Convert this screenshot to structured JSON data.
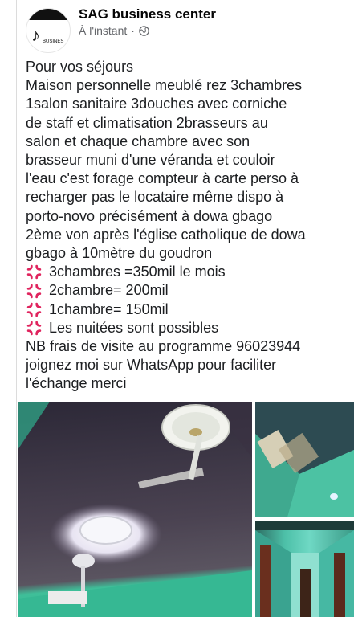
{
  "post_header": {
    "page_name": "SAG business center",
    "timestamp": "À l'instant",
    "separator": "·",
    "avatar_text": "BUSINES"
  },
  "post_body": {
    "lines": [
      "Pour vos séjours",
      "Maison personnelle  meublé rez 3chambres",
      "1salon sanitaire 3douches avec corniche",
      "de staff et climatisation  2brasseurs au",
      "salon et chaque chambre avec son",
      "brasseur muni d'une véranda et couloir",
      "l'eau c'est forage compteur à carte perso à",
      "recharger pas le locataire même dispo à",
      "porto-novo précisément à dowa gbago",
      "2ème von après l'église catholique de dowa",
      "gbago à 10mètre du goudron"
    ],
    "items": [
      "3chambres =350mil le mois",
      "2chambre= 200mil",
      "1chambre= 150mil",
      "Les nuitées sont possibles"
    ],
    "closing_lines": [
      "NB frais de visite au programme 96023944",
      "joignez moi sur WhatsApp pour faciliter",
      "l'échange merci"
    ]
  },
  "icons": {
    "bullet": "anger-symbol-icon",
    "audience": "globe-icon",
    "bullet_color": "#e0245e"
  }
}
